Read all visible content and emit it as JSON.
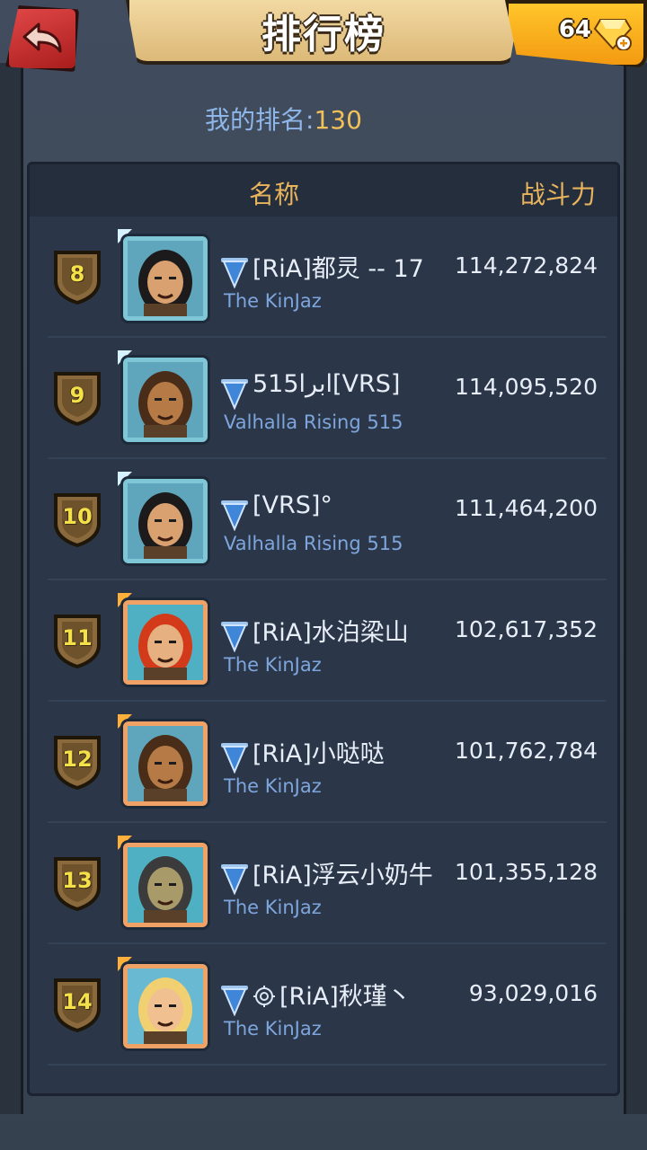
{
  "header": {
    "title": "排行榜",
    "gem_count": "64"
  },
  "my_rank": {
    "label": "我的排名:",
    "value": "130"
  },
  "table": {
    "col_name": "名称",
    "col_power": "战斗力"
  },
  "rows": [
    {
      "rank": "8",
      "name": "[RiA]都灵 -- 17",
      "guild": "The KinJaz",
      "power": "114,272,824",
      "frame": "blue",
      "avatar_icon": "hero-long-hair-icon"
    },
    {
      "rank": "9",
      "name": "515ابرا[VRS]",
      "guild": "Valhalla Rising 515",
      "power": "114,095,520",
      "frame": "blue",
      "avatar_icon": "hero-bearded-icon"
    },
    {
      "rank": "10",
      "name": "[VRS]°",
      "guild": "Valhalla Rising 515",
      "power": "111,464,200",
      "frame": "blue",
      "avatar_icon": "hero-long-hair-icon"
    },
    {
      "rank": "11",
      "name": "[RiA]水泊梁山",
      "guild": "The KinJaz",
      "power": "102,617,352",
      "frame": "orange",
      "avatar_icon": "hero-redhead-icon"
    },
    {
      "rank": "12",
      "name": "[RiA]小哒哒",
      "guild": "The KinJaz",
      "power": "101,762,784",
      "frame": "orange",
      "avatar_icon": "hero-bearded-icon"
    },
    {
      "rank": "13",
      "name": "[RiA]浮云小奶牛",
      "guild": "The KinJaz",
      "power": "101,355,128",
      "frame": "orange",
      "avatar_icon": "hero-beast-icon"
    },
    {
      "rank": "14",
      "name": "[RiA]秋瑾丶",
      "guild": "The KinJaz",
      "power": "93,029,016",
      "frame": "orange",
      "avatar_icon": "hero-blonde-icon",
      "prefix_icon": "gear-icon"
    }
  ],
  "colors": {
    "accent_gold": "#e9b45b",
    "rank_yellow": "#f0c05a",
    "guild_blue": "#7ea6dd",
    "panel_bg": "#2b3749"
  }
}
